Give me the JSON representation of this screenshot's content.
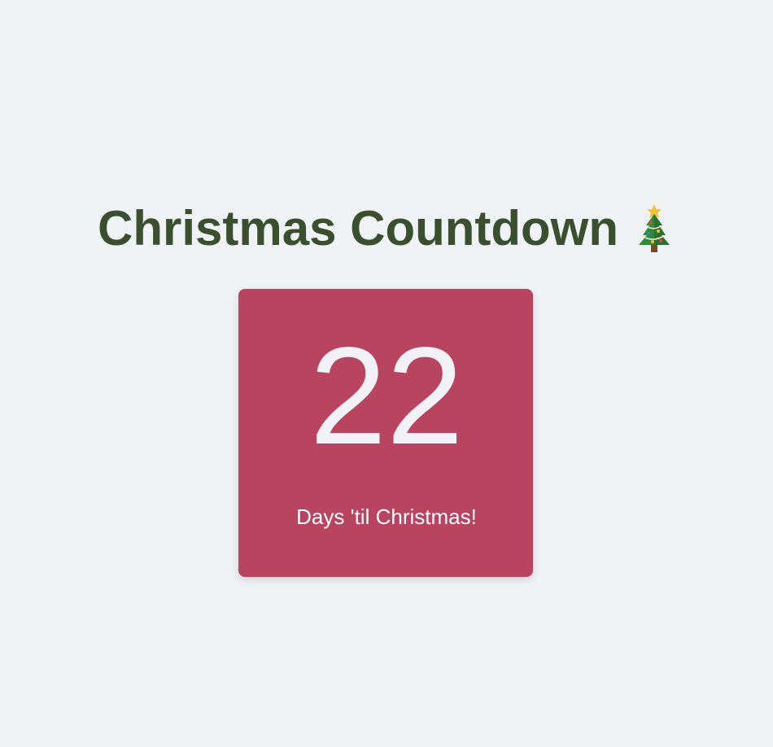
{
  "header": {
    "title": "Christmas Countdown",
    "icon": "christmas-tree-icon"
  },
  "countdown": {
    "days": "22",
    "label": "Days 'til Christmas!"
  },
  "colors": {
    "background": "#f0f3f6",
    "title": "#3a4f2e",
    "card": "#b8445f",
    "card_text": "#f1f2f6"
  }
}
